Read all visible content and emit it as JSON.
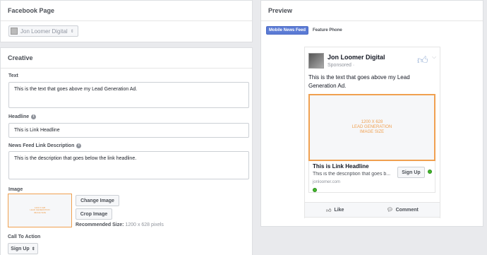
{
  "facebook_page": {
    "title": "Facebook Page",
    "selected_page": "Jon Loomer Digital",
    "caret": "⇕"
  },
  "creative": {
    "title": "Creative",
    "text_label": "Text",
    "text_value": "This is the text that goes above my Lead Generation Ad.",
    "headline_label": "Headline",
    "headline_value": "This is Link Headline",
    "description_label": "News Feed Link Description",
    "description_value": "This is the description that goes below the link headline.",
    "image_label": "Image",
    "image_placeholder": "1200 X 628\nLEAD GENERATION\nIMAGE SIZE",
    "change_image": "Change Image",
    "crop_image": "Crop Image",
    "recommended_label": "Recommended Size:",
    "recommended_value": "1200 x 628 pixels",
    "cta_label": "Call To Action",
    "cta_value": "Sign Up",
    "cta_caret": "⇕"
  },
  "preview": {
    "title": "Preview",
    "tab_mobile": "Mobile News Feed",
    "tab_feature": "Feature Phone",
    "page_name": "Jon Loomer Digital",
    "sponsored": "Sponsored",
    "sponsored_icon": "·",
    "chevron": "⌵",
    "post_text": "This is the text that goes above my Lead Generation Ad.",
    "image_placeholder": "1200 X 628\nLEAD GENERATION\nIMAGE SIZE",
    "link_headline": "This is Link Headline",
    "link_description": "This is the description that goes b...",
    "domain": "jonloomer.com",
    "cta": "Sign Up",
    "like": "Like",
    "comment": "Comment"
  },
  "colors": {
    "accent": "#5b7bd5",
    "image_border": "#f0a050",
    "status_dot": "#42b72a"
  },
  "icons": [
    "info-icon",
    "thumbs-up-icon",
    "chevron-down-icon",
    "like-icon",
    "comment-icon",
    "globe-icon"
  ]
}
